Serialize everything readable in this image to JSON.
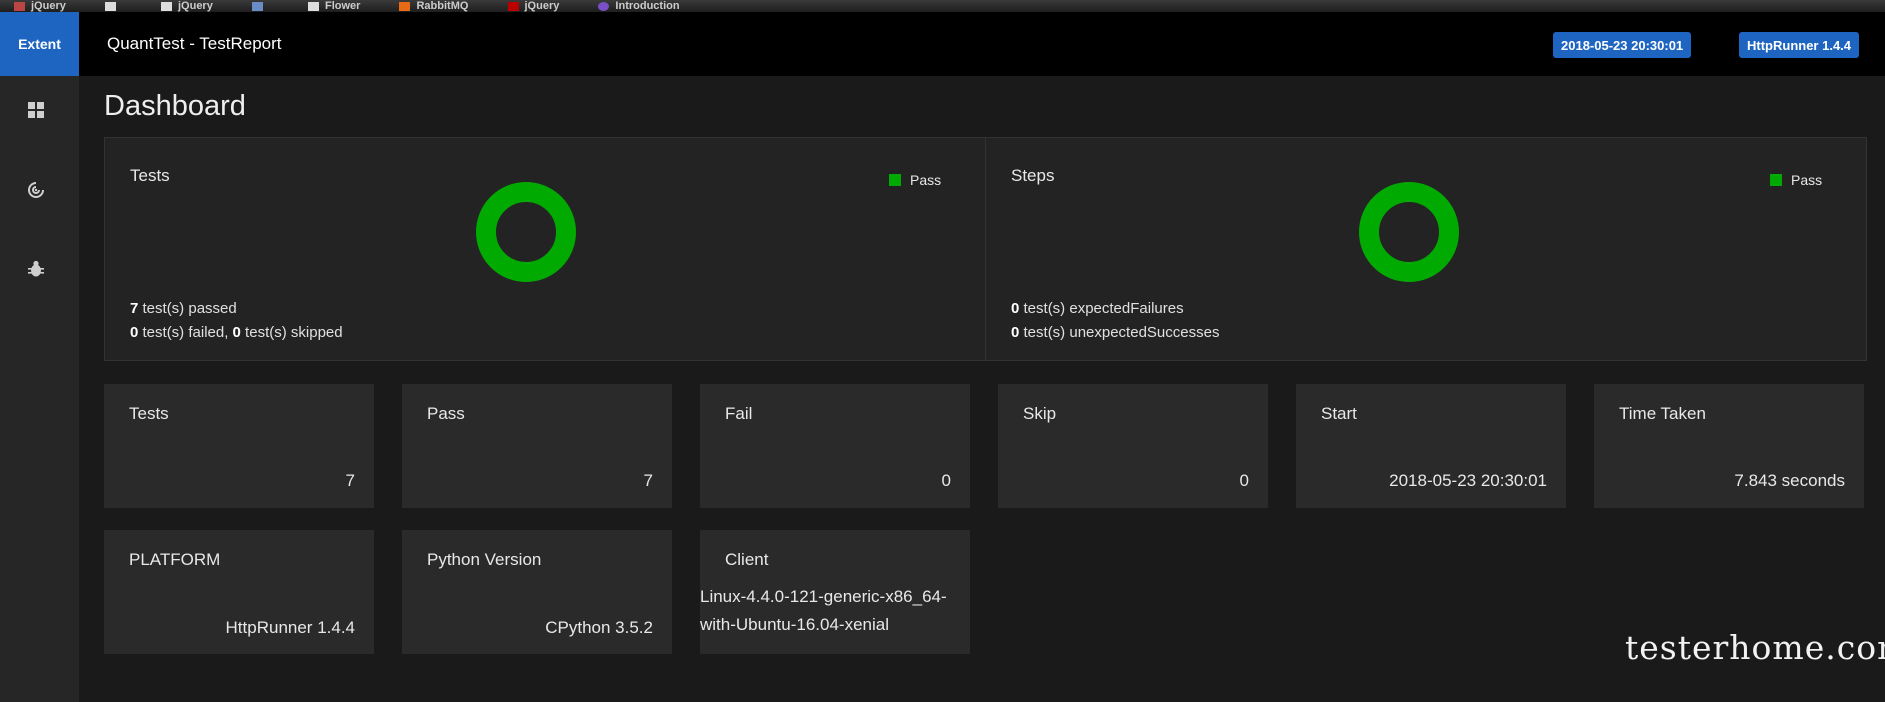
{
  "browser": {
    "bookmarks": [
      "",
      "",
      "jQuery",
      "",
      "jQuery",
      "",
      "",
      "",
      "Flower",
      "RabbitMQ",
      "jQuery",
      "Introduction",
      ""
    ]
  },
  "header": {
    "brand": "Extent",
    "title": "QuantTest - TestReport",
    "date_badge": "2018-05-23 20:30:01",
    "version_badge": "HttpRunner 1.4.4"
  },
  "sidebar": {
    "items": [
      {
        "icon": "dashboard-icon"
      },
      {
        "icon": "target-icon"
      },
      {
        "icon": "bug-icon"
      }
    ]
  },
  "dashboard": {
    "title": "Dashboard",
    "tests_panel": {
      "title": "Tests",
      "legend": "Pass",
      "passed_count": "7",
      "passed_text": " test(s) passed",
      "failed_count": "0",
      "failed_text": " test(s) failed, ",
      "skipped_count": "0",
      "skipped_text": " test(s) skipped",
      "pass_fraction": 1.0,
      "color": "#00aa00"
    },
    "steps_panel": {
      "title": "Steps",
      "legend": "Pass",
      "expected_failures_count": "0",
      "expected_failures_text": " test(s) expectedFailures",
      "unexpected_successes_count": "0",
      "unexpected_successes_text": " test(s) unexpectedSuccesses",
      "pass_fraction": 1.0,
      "color": "#00aa00"
    },
    "stats": [
      {
        "label": "Tests",
        "value": "7"
      },
      {
        "label": "Pass",
        "value": "7"
      },
      {
        "label": "Fail",
        "value": "0"
      },
      {
        "label": "Skip",
        "value": "0"
      },
      {
        "label": "Start",
        "value": "2018-05-23 20:30:01"
      },
      {
        "label": "Time Taken",
        "value": "7.843 seconds"
      }
    ],
    "environment": [
      {
        "label": "PLATFORM",
        "value": "HttpRunner 1.4.4"
      },
      {
        "label": "Python Version",
        "value": "CPython 3.5.2"
      },
      {
        "label": "Client",
        "value": "Linux-4.4.0-121-generic-x86_64-with-Ubuntu-16.04-xenial"
      }
    ]
  },
  "watermark": "testerhome.com"
}
